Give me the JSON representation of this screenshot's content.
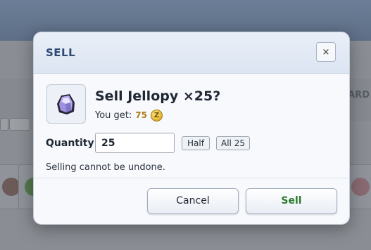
{
  "background": {
    "right_text": "ARD"
  },
  "dialog": {
    "title": "SELL",
    "close_label": "×",
    "item": {
      "title": "Sell Jellopy ×25?",
      "icon": "jellopy-item-icon",
      "you_get_label": "You get:",
      "price": "75",
      "currency_symbol": "Z"
    },
    "quantity": {
      "label": "Quantity",
      "value": "25",
      "half_label": "Half",
      "all_label": "All 25"
    },
    "warning": "Selling cannot be undone.",
    "cancel_label": "Cancel",
    "sell_label": "Sell"
  },
  "colors": {
    "header_title": "#2c4a72",
    "price": "#b07a12",
    "sell_button_text": "#2e7a2e",
    "zeny_coin": "#e0b22a"
  }
}
